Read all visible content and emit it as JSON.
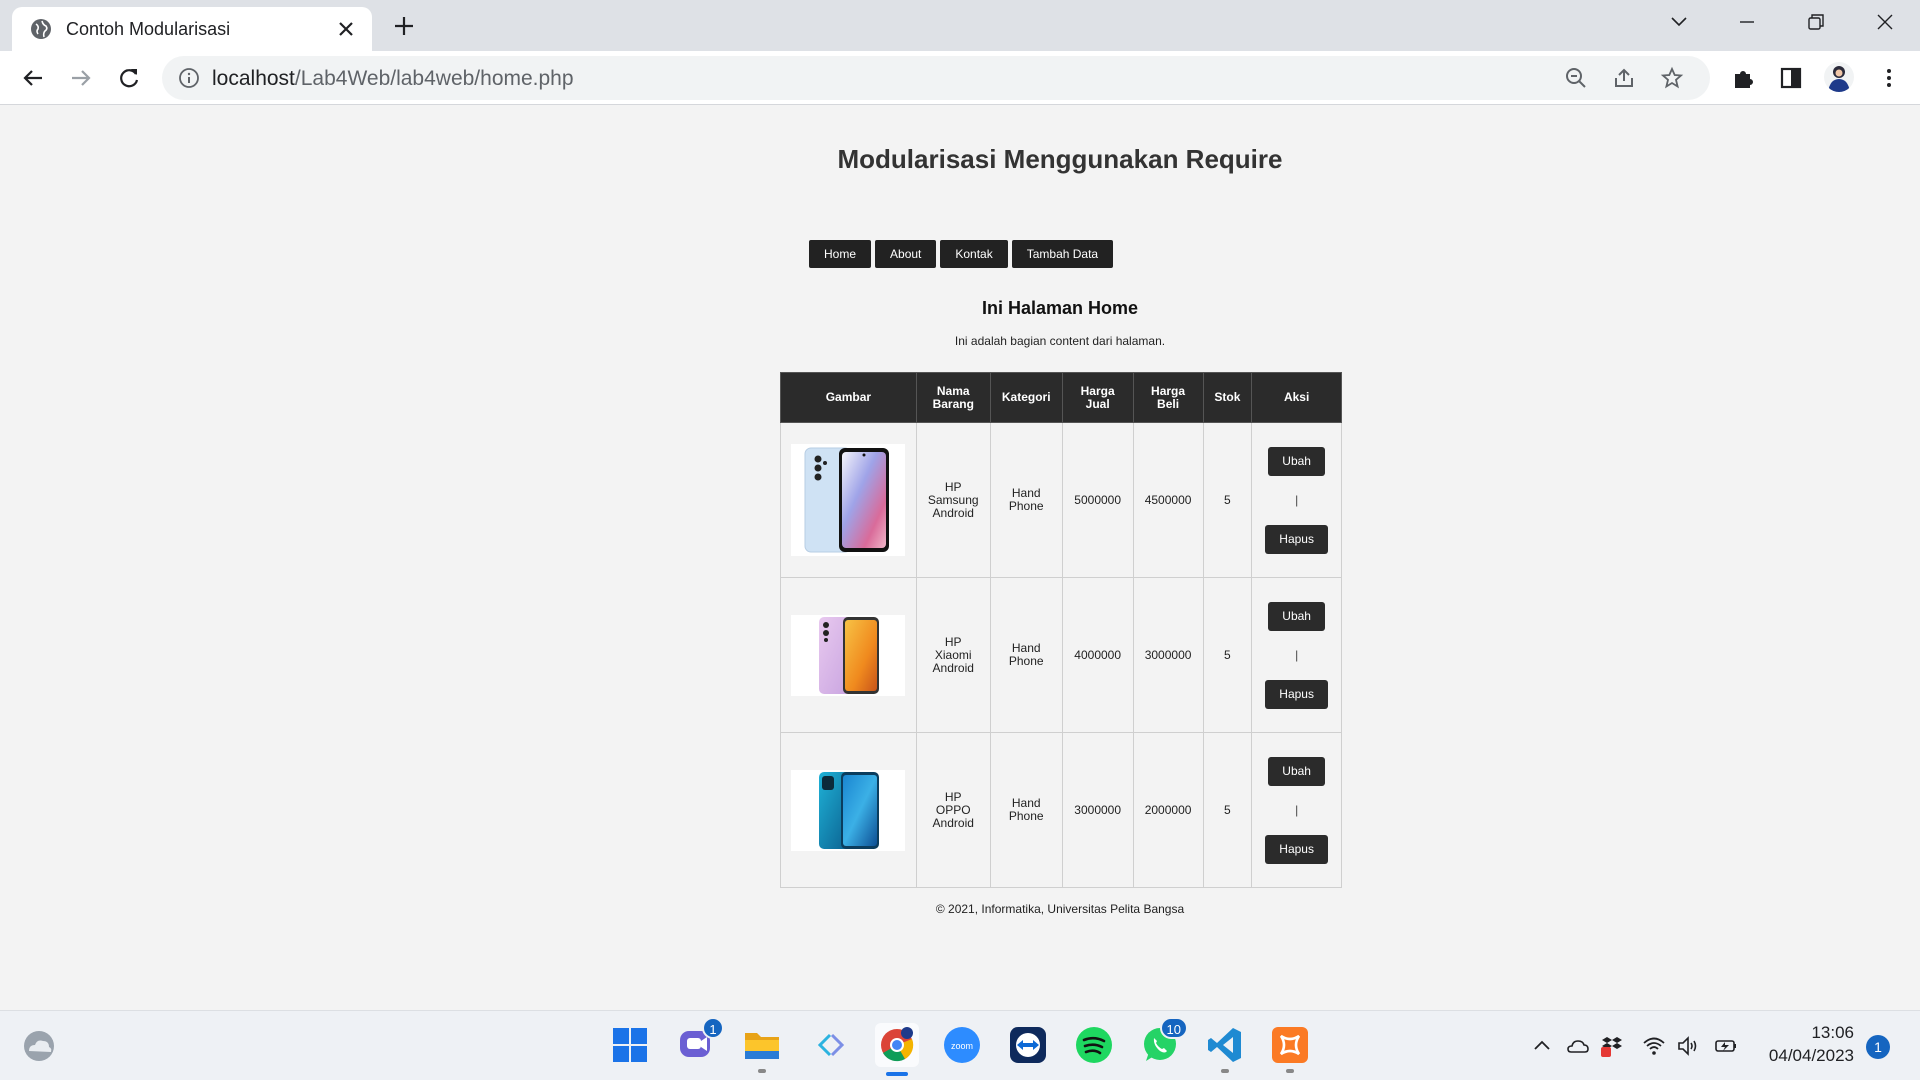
{
  "browser": {
    "tab_title": "Contoh Modularisasi",
    "url_host": "localhost",
    "url_path": "/Lab4Web/lab4web/home.php"
  },
  "page": {
    "header_title": "Modularisasi Menggunakan Require",
    "menu": [
      "Home",
      "About",
      "Kontak",
      "Tambah Data"
    ],
    "content_title": "Ini Halaman Home",
    "content_desc": "Ini adalah bagian content dari halaman.",
    "table": {
      "headers": [
        "Gambar",
        "Nama Barang",
        "Kategori",
        "Harga Jual",
        "Harga Beli",
        "Stok",
        "Aksi"
      ],
      "rows": [
        {
          "image": "samsung-phone-image",
          "nama": "HP Samsung Android",
          "kategori": "Hand Phone",
          "harga_jual": "5000000",
          "harga_beli": "4500000",
          "stok": "5"
        },
        {
          "image": "xiaomi-phone-image",
          "nama": "HP Xiaomi Android",
          "kategori": "Hand Phone",
          "harga_jual": "4000000",
          "harga_beli": "3000000",
          "stok": "5"
        },
        {
          "image": "oppo-phone-image",
          "nama": "HP OPPO Android",
          "kategori": "Hand Phone",
          "harga_jual": "3000000",
          "harga_beli": "2000000",
          "stok": "5"
        }
      ],
      "edit_label": "Ubah",
      "separator": "|",
      "delete_label": "Hapus"
    },
    "footer": "© 2021, Informatika, Universitas Pelita Bangsa"
  },
  "taskbar": {
    "teams_badge": "1",
    "whatsapp_badge": "10",
    "time": "13:06",
    "date": "04/04/2023",
    "notification_count": "1"
  }
}
